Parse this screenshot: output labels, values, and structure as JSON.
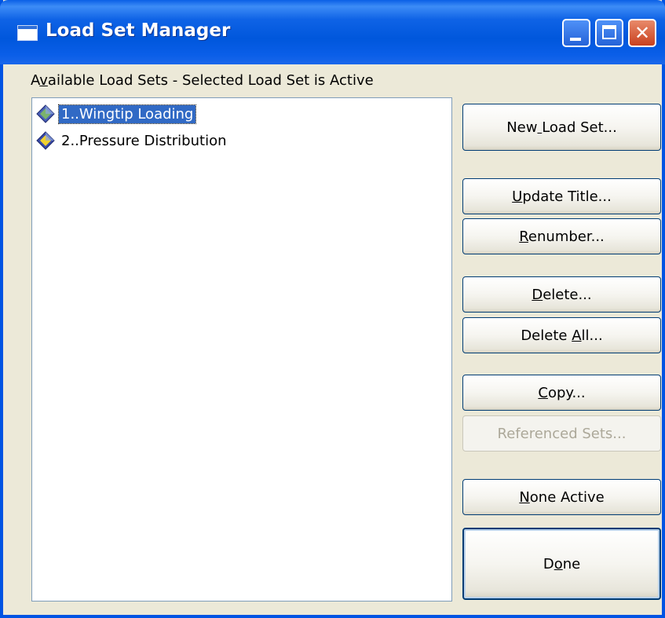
{
  "window": {
    "title": "Load Set Manager",
    "icon": "window-app-icon",
    "controls": {
      "minimize": "minimize-icon",
      "maximize": "maximize-icon",
      "close": "close-icon"
    }
  },
  "list": {
    "caption": "Available Load Sets - Selected Load Set is Active",
    "items": [
      {
        "label": "1..Wingtip Loading",
        "selected": true,
        "icon": "load-set-icon"
      },
      {
        "label": "2..Pressure Distribution",
        "selected": false,
        "icon": "load-set-icon"
      }
    ]
  },
  "buttons": {
    "new_load_set": "New Load Set...",
    "update_title": "Update Title...",
    "renumber": "Renumber...",
    "delete": "Delete...",
    "delete_all": "Delete All...",
    "copy": "Copy...",
    "referenced_sets": "Referenced Sets...",
    "none_active": "None Active",
    "done": "Done"
  },
  "colors": {
    "titlebar": "#0054e3",
    "dialog_bg": "#ece9d8",
    "selection": "#316ac5",
    "disabled_text": "#aca899"
  }
}
